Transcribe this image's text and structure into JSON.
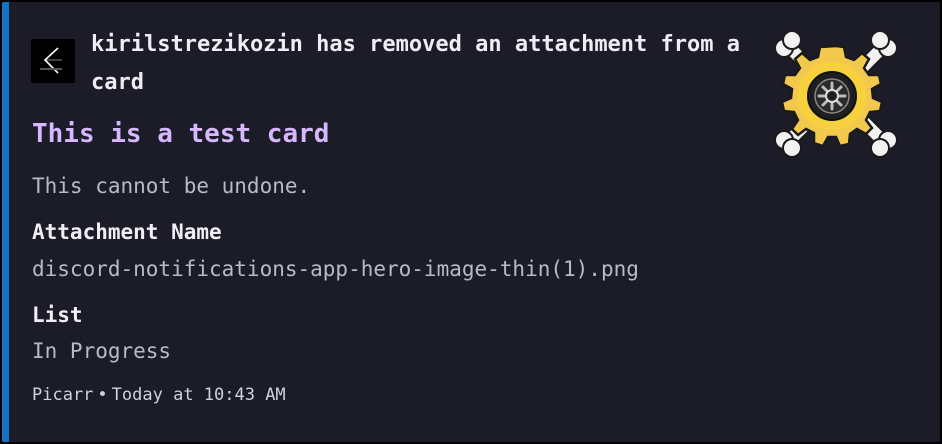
{
  "colors": {
    "accent": "#1573c6",
    "background": "#1c1c29",
    "title": "#d7b7ff"
  },
  "embed": {
    "author": {
      "avatar_icon": "k-logo-avatar",
      "name": "kirilstrezikozin has removed an attachment from a card"
    },
    "title": "This is a test card",
    "description": "This cannot be undone.",
    "fields": [
      {
        "name": "Attachment Name",
        "value": "discord-notifications-app-hero-image-thin(1).png"
      },
      {
        "name": "List",
        "value": "In Progress"
      }
    ],
    "footer": {
      "text": "Picarr",
      "separator": "•",
      "timestamp": "Today at 10:43 AM"
    },
    "thumbnail_icon": "gear-skull-crossbones-icon"
  }
}
